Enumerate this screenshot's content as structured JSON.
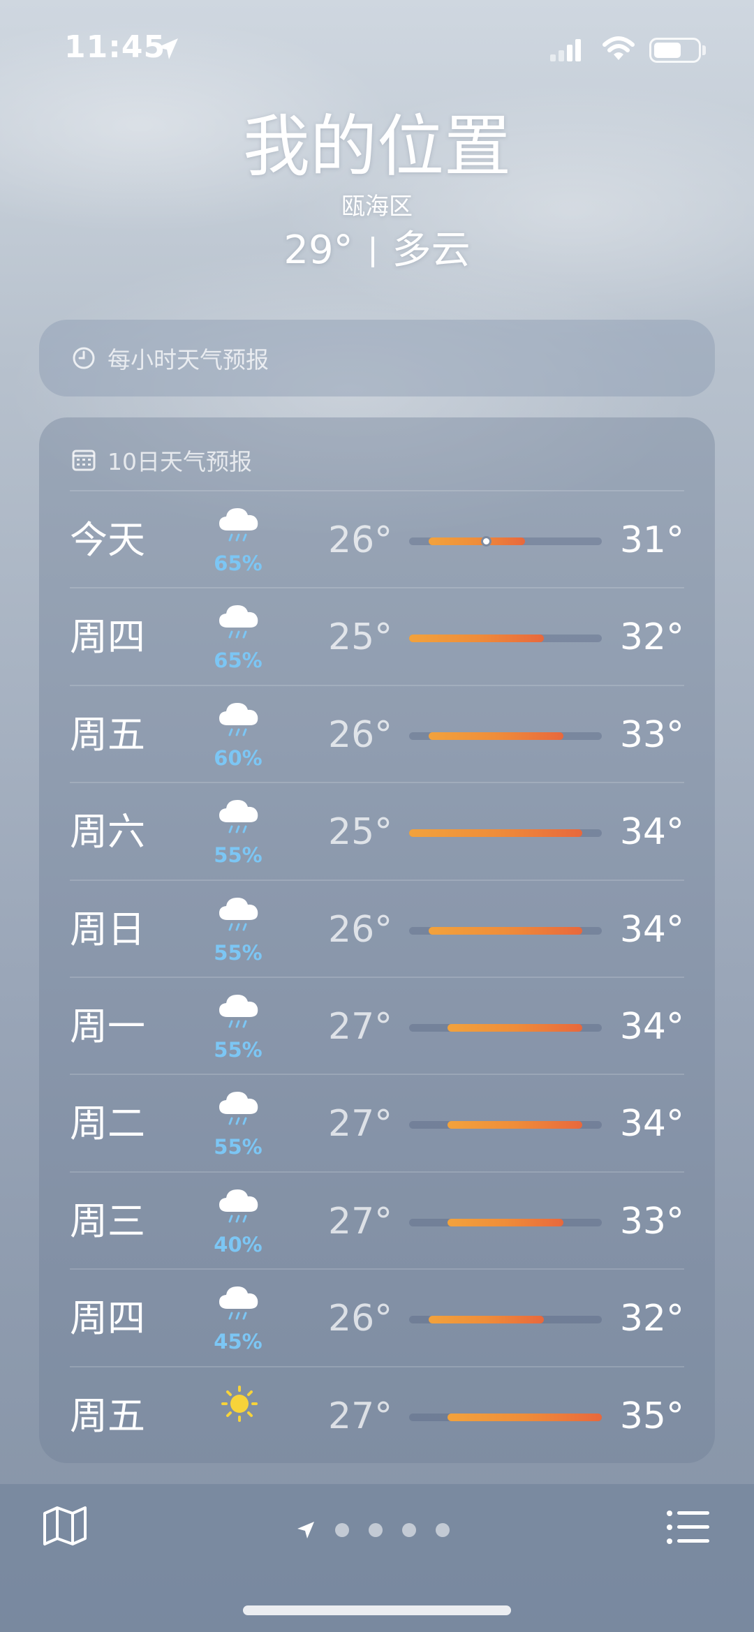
{
  "status_bar": {
    "time": "11:45"
  },
  "header": {
    "location": "我的位置",
    "district": "瓯海区",
    "temperature": "29°",
    "condition": "多云"
  },
  "hourly": {
    "label": "每小时天气预报",
    "icon": "clock-icon"
  },
  "daily": {
    "label": "10日天气预报",
    "icon": "calendar-icon",
    "range": {
      "min": 25,
      "max": 35
    },
    "rows": [
      {
        "day": "今天",
        "icon": "cloud-rain-icon",
        "precip": "65%",
        "low": "26°",
        "high": "31°",
        "low_val": 26,
        "high_val": 31,
        "now_val": 29
      },
      {
        "day": "周四",
        "icon": "cloud-rain-icon",
        "precip": "65%",
        "low": "25°",
        "high": "32°",
        "low_val": 25,
        "high_val": 32
      },
      {
        "day": "周五",
        "icon": "cloud-rain-icon",
        "precip": "60%",
        "low": "26°",
        "high": "33°",
        "low_val": 26,
        "high_val": 33
      },
      {
        "day": "周六",
        "icon": "cloud-rain-icon",
        "precip": "55%",
        "low": "25°",
        "high": "34°",
        "low_val": 25,
        "high_val": 34
      },
      {
        "day": "周日",
        "icon": "cloud-rain-icon",
        "precip": "55%",
        "low": "26°",
        "high": "34°",
        "low_val": 26,
        "high_val": 34
      },
      {
        "day": "周一",
        "icon": "cloud-rain-icon",
        "precip": "55%",
        "low": "27°",
        "high": "34°",
        "low_val": 27,
        "high_val": 34
      },
      {
        "day": "周二",
        "icon": "cloud-rain-icon",
        "precip": "55%",
        "low": "27°",
        "high": "34°",
        "low_val": 27,
        "high_val": 34
      },
      {
        "day": "周三",
        "icon": "cloud-rain-icon",
        "precip": "40%",
        "low": "27°",
        "high": "33°",
        "low_val": 27,
        "high_val": 33
      },
      {
        "day": "周四",
        "icon": "cloud-rain-icon",
        "precip": "45%",
        "low": "26°",
        "high": "32°",
        "low_val": 26,
        "high_val": 32
      },
      {
        "day": "周五",
        "icon": "sun-icon",
        "precip": "",
        "low": "27°",
        "high": "35°",
        "low_val": 27,
        "high_val": 35
      }
    ]
  },
  "colors": {
    "precip": "#7cc6f4",
    "bar_start": "#f2a23c",
    "bar_end": "#e8683c",
    "sun": "#f7d33a"
  }
}
